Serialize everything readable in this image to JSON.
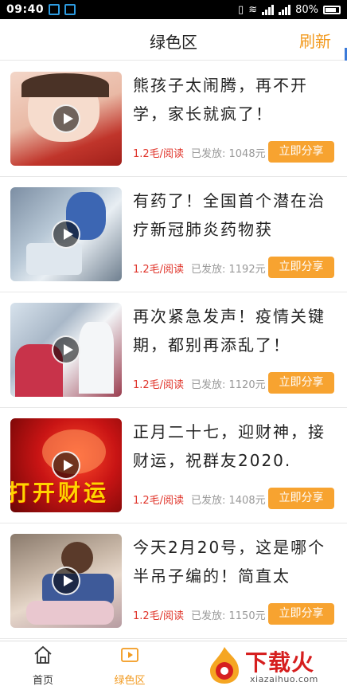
{
  "statusbar": {
    "time": "09:40",
    "battery": "80%"
  },
  "header": {
    "title": "绿色区",
    "refresh": "刷新"
  },
  "articles": [
    {
      "title": "熊孩子太闹腾，再不开学，家长就疯了！",
      "price": "1.2毛/阅读",
      "sent": "已发放: 1048元",
      "share": "立即分享"
    },
    {
      "title": "有药了！全国首个潜在治疗新冠肺炎药物获",
      "price": "1.2毛/阅读",
      "sent": "已发放: 1192元",
      "share": "立即分享"
    },
    {
      "title": "再次紧急发声！疫情关键期，都别再添乱了！",
      "price": "1.2毛/阅读",
      "sent": "已发放: 1120元",
      "share": "立即分享"
    },
    {
      "title": "正月二十七，迎财神，接财运，祝群友2020.",
      "price": "1.2毛/阅读",
      "sent": "已发放: 1408元",
      "share": "立即分享",
      "overlay": "打开财运"
    },
    {
      "title": "今天2月20号，这是哪个半吊子编的！简直太",
      "price": "1.2毛/阅读",
      "sent": "已发放: 1150元",
      "share": "立即分享"
    }
  ],
  "tabbar": {
    "home": "首页",
    "green": "绿色区"
  },
  "watermark": {
    "main": "下载火",
    "sub": "xiazaihuo.com"
  },
  "colors": {
    "accent": "#f29a1f",
    "share_bg": "#f7a330",
    "price": "#e0352b"
  }
}
